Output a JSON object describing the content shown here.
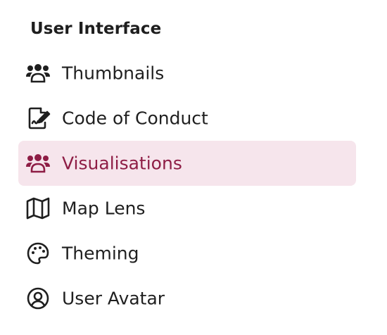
{
  "section": {
    "title": "User Interface"
  },
  "nav": {
    "items": [
      {
        "label": "Thumbnails",
        "icon": "people-group-icon",
        "active": false
      },
      {
        "label": "Code of Conduct",
        "icon": "document-signature-icon",
        "active": false
      },
      {
        "label": "Visualisations",
        "icon": "people-group-icon",
        "active": true
      },
      {
        "label": "Map Lens",
        "icon": "map-icon",
        "active": false
      },
      {
        "label": "Theming",
        "icon": "palette-icon",
        "active": false
      },
      {
        "label": "User Avatar",
        "icon": "user-circle-icon",
        "active": false
      }
    ]
  },
  "colors": {
    "active_background": "#f6e5ec",
    "active_text": "#8e1d45",
    "text": "#1f1f1f"
  }
}
